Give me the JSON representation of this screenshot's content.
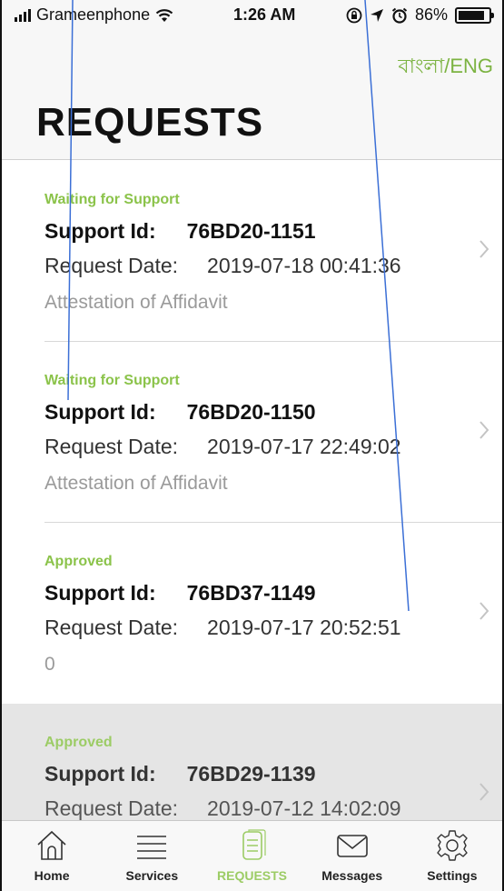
{
  "status_bar": {
    "carrier": "Grameenphone",
    "time": "1:26 AM",
    "battery": "86%",
    "battery_level": 0.86
  },
  "header": {
    "lang_toggle": "বাংলা/ENG",
    "title": "REQUESTS"
  },
  "requests": [
    {
      "status": "Waiting for Support",
      "support_label": "Support Id:",
      "support_id": "76BD20-1151",
      "date_label": "Request Date:",
      "date": "2019-07-18 00:41:36",
      "description": "Attestation of Affidavit"
    },
    {
      "status": "Waiting for Support",
      "support_label": "Support Id:",
      "support_id": "76BD20-1150",
      "date_label": "Request Date:",
      "date": "2019-07-17 22:49:02",
      "description": "Attestation of Affidavit"
    },
    {
      "status": "Approved",
      "support_label": "Support Id:",
      "support_id": "76BD37-1149",
      "date_label": "Request Date:",
      "date": "2019-07-17 20:52:51",
      "description": "0"
    },
    {
      "status": "Approved",
      "support_label": "Support Id:",
      "support_id": "76BD29-1139",
      "date_label": "Request Date:",
      "date": "2019-07-12 14:02:09",
      "description": ""
    }
  ],
  "tabs": [
    {
      "label": "Home",
      "icon": "home-icon"
    },
    {
      "label": "Services",
      "icon": "menu-icon"
    },
    {
      "label": "REQUESTS",
      "icon": "document-icon"
    },
    {
      "label": "Messages",
      "icon": "envelope-icon"
    },
    {
      "label": "Settings",
      "icon": "gear-icon"
    }
  ],
  "colors": {
    "accent": "#8bc34a",
    "active_tab": "#9ccc65",
    "annotation_line": "#3b6fd6"
  }
}
